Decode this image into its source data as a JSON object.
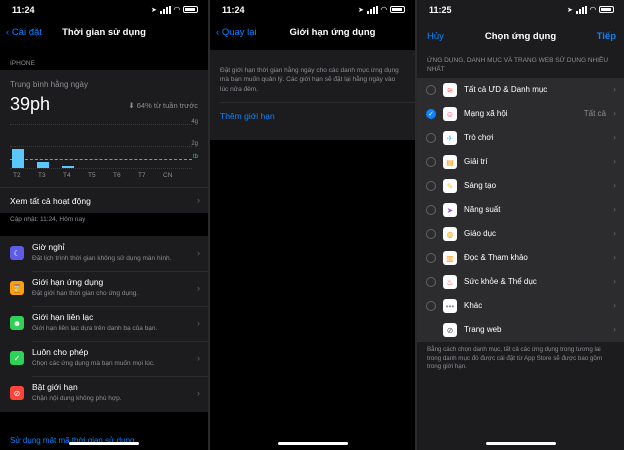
{
  "screen1": {
    "status": {
      "time": "11:24"
    },
    "nav": {
      "back": "Cài đặt",
      "title": "Thời gian sử dụng"
    },
    "section_label": "IPHONE",
    "summary": {
      "caption": "Trung bình hằng ngày",
      "value": "39ph",
      "change": "64% từ tuần trước",
      "change_icon": "arrow-down-circle-icon"
    },
    "chart_data": {
      "type": "bar",
      "categories": [
        "T2",
        "T3",
        "T4",
        "T5",
        "T6",
        "T7",
        "CN"
      ],
      "values": [
        0.45,
        0.15,
        0.05,
        0,
        0,
        0,
        0
      ],
      "tick_labels": [
        "4g",
        "2g",
        "tb"
      ],
      "avg_label": "tb",
      "ylim": [
        0,
        6
      ]
    },
    "see_all": "Xem tất cả hoạt động",
    "updated": "Cập nhật: 11:24, Hôm nay",
    "items": [
      {
        "icon": "moon-icon",
        "color": "#5e5ce6",
        "title": "Giờ nghỉ",
        "subtitle": "Đặt lịch trình thời gian không sử dụng màn hình."
      },
      {
        "icon": "hourglass-icon",
        "color": "#ff9f0a",
        "title": "Giới hạn ứng dụng",
        "subtitle": "Đặt giới hạn thời gian cho ứng dụng."
      },
      {
        "icon": "person-icon",
        "color": "#30d158",
        "title": "Giới hạn liên lạc",
        "subtitle": "Giới hạn liên lạc dựa trên danh bạ của bạn."
      },
      {
        "icon": "check-icon",
        "color": "#30d158",
        "title": "Luôn cho phép",
        "subtitle": "Chọn các ứng dụng mà bạn muốn mọi lúc."
      },
      {
        "icon": "block-icon",
        "color": "#ff453a",
        "title": "Bật giới hạn",
        "subtitle": "Chặn nội dung không phù hợp."
      }
    ],
    "passcode_link": "Sử dụng mật mã thời gian sử dụng"
  },
  "screen2": {
    "status": {
      "time": "11:24"
    },
    "nav": {
      "back": "Quay lại",
      "title": "Giới hạn ứng dụng"
    },
    "description": "Đặt giới hạn thời gian hằng ngày cho các danh mục ứng dụng mà bạn muốn quản lý. Các giới hạn sẽ đặt lại hằng ngày vào lúc nửa đêm.",
    "add_limit": "Thêm giới hạn"
  },
  "screen3": {
    "status": {
      "time": "11:25"
    },
    "nav": {
      "left": "Hủy",
      "title": "Chọn ứng dụng",
      "right": "Tiếp"
    },
    "header": "ỨNG DỤNG, DANH MỤC VÀ TRANG WEB SỬ DỤNG NHIỀU NHẤT",
    "rows": [
      {
        "label": "Tất cả ƯD & Danh mục",
        "icon": "stack-icon",
        "glyph": "≋",
        "selected": false,
        "value": ""
      },
      {
        "label": "Mạng xã hội",
        "icon": "chat-bubble-icon",
        "glyph": "☺",
        "selected": true,
        "value": "Tất cả"
      },
      {
        "label": "Trò chơi",
        "icon": "rocket-icon",
        "glyph": "✈",
        "selected": false,
        "value": ""
      },
      {
        "label": "Giải trí",
        "icon": "popcorn-icon",
        "glyph": "▤",
        "selected": false,
        "value": ""
      },
      {
        "label": "Sáng tạo",
        "icon": "palette-icon",
        "glyph": "✎",
        "selected": false,
        "value": ""
      },
      {
        "label": "Năng suất",
        "icon": "paper-plane-icon",
        "glyph": "➤",
        "selected": false,
        "value": ""
      },
      {
        "label": "Giáo dục",
        "icon": "globe-icon",
        "glyph": "◍",
        "selected": false,
        "value": ""
      },
      {
        "label": "Đọc & Tham khảo",
        "icon": "book-icon",
        "glyph": "▥",
        "selected": false,
        "value": ""
      },
      {
        "label": "Sức khỏe & Thể dục",
        "icon": "bike-icon",
        "glyph": "♨",
        "selected": false,
        "value": ""
      },
      {
        "label": "Khác",
        "icon": "ellipsis-icon",
        "glyph": "•••",
        "selected": false,
        "value": ""
      },
      {
        "label": "Trang web",
        "icon": "compass-icon",
        "glyph": "⊘",
        "selected": null,
        "value": ""
      }
    ],
    "footer": "Bằng cách chọn danh mục, tất cả các ứng dụng trong tương lai trong danh mục đó được cài đặt từ App Store sẽ được bao gồm trong giới hạn."
  }
}
